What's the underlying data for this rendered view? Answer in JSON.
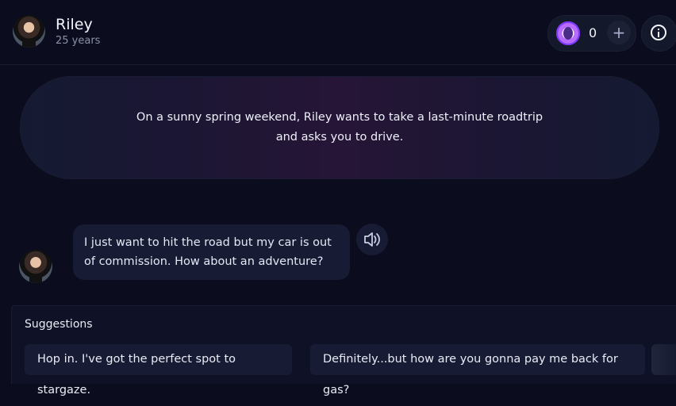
{
  "header": {
    "name": "Riley",
    "age": "25 years",
    "coin_count": "0",
    "plus_label": "+"
  },
  "scenario": {
    "text": "On a sunny spring weekend, Riley wants to take a last-minute roadtrip and asks you to drive."
  },
  "message": {
    "text": "I just want to hit the road but my car is out of commission. How about an adventure?"
  },
  "suggestions": {
    "title": "Suggestions",
    "items": [
      "Hop in. I've got the perfect spot to stargaze.",
      "Definitely...but how are you gonna pay me back for gas?"
    ]
  },
  "icons": {
    "coin": "coin-icon",
    "plus": "plus-icon",
    "info": "info-icon",
    "speaker": "speaker-icon"
  },
  "colors": {
    "background": "#0b0d1f",
    "bubble": "#171c34",
    "accent": "#b86bff"
  }
}
